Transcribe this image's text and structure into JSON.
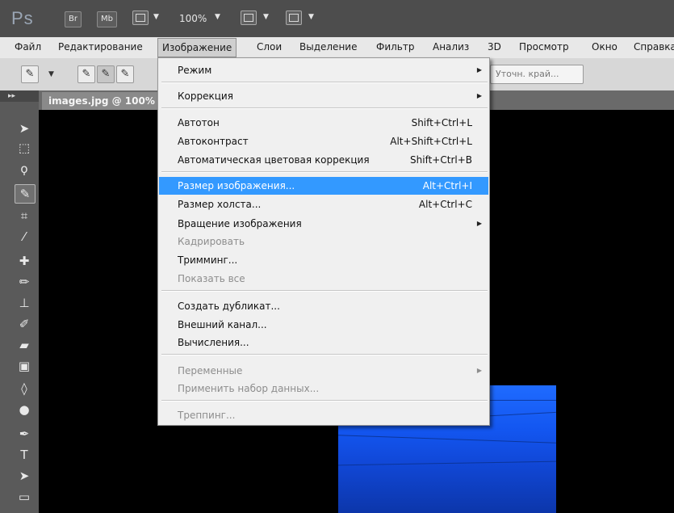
{
  "appbar": {
    "logo": "Ps",
    "bridge_label": "Br",
    "minibridge_label": "Mb",
    "zoom": "100%"
  },
  "menubar": {
    "items": [
      "Файл",
      "Редактирование",
      "Изображение",
      "Слои",
      "Выделение",
      "Фильтр",
      "Анализ",
      "3D",
      "Просмотр",
      "Окно",
      "Справка"
    ]
  },
  "options": {
    "refine_edge": "Уточн. край..."
  },
  "document": {
    "tab_title": "images.jpg @ 100% ("
  },
  "dropdown": {
    "items": [
      {
        "label": "Режим",
        "submenu": true
      },
      {
        "label": "Коррекция",
        "submenu": true
      },
      {
        "label": "Автотон",
        "shortcut": "Shift+Ctrl+L"
      },
      {
        "label": "Автоконтраст",
        "shortcut": "Alt+Shift+Ctrl+L"
      },
      {
        "label": "Автоматическая цветовая коррекция",
        "shortcut": "Shift+Ctrl+B"
      },
      {
        "label": "Размер изображения...",
        "shortcut": "Alt+Ctrl+I",
        "highlighted": true
      },
      {
        "label": "Размер холста...",
        "shortcut": "Alt+Ctrl+C"
      },
      {
        "label": "Вращение изображения",
        "submenu": true
      },
      {
        "label": "Кадрировать",
        "disabled": true
      },
      {
        "label": "Тримминг..."
      },
      {
        "label": "Показать все",
        "disabled": true
      },
      {
        "label": "Создать дубликат..."
      },
      {
        "label": "Внешний канал..."
      },
      {
        "label": "Вычисления..."
      },
      {
        "label": "Переменные",
        "disabled": true,
        "submenu": true
      },
      {
        "label": "Применить набор данных...",
        "disabled": true
      },
      {
        "label": "Треппинг...",
        "disabled": true
      }
    ]
  },
  "colors": {
    "highlight": "#3399ff",
    "menubar_bg": "#e8e8e8",
    "panel_bg": "#5a5a5a",
    "photo_blue": "#1356f0"
  },
  "icons": {
    "tools": [
      "move-icon",
      "marquee-icon",
      "lasso-icon",
      "quick-selection-icon",
      "crop-icon",
      "eyedropper-icon",
      "healing-brush-icon",
      "brush-icon",
      "clone-stamp-icon",
      "history-brush-icon",
      "eraser-icon",
      "gradient-icon",
      "blur-icon",
      "dodge-icon",
      "pen-icon",
      "type-icon",
      "path-selection-icon"
    ]
  }
}
